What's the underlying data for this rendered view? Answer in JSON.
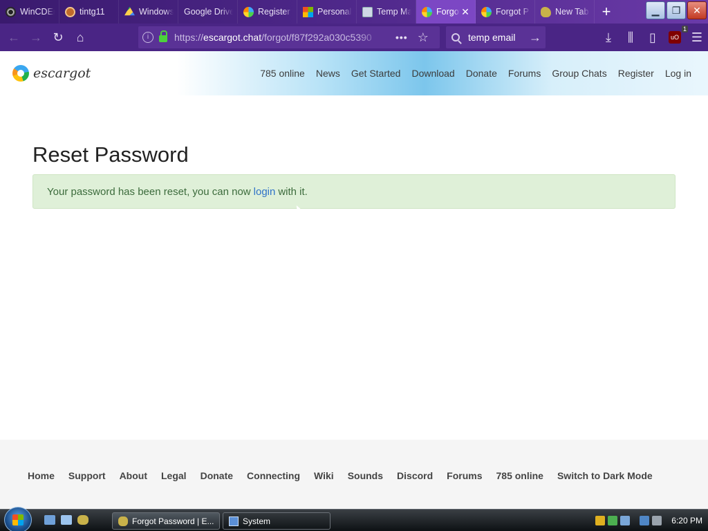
{
  "browser": {
    "tabs": [
      {
        "label": "WinCDEmu",
        "icon": "wincdemu-icon"
      },
      {
        "label": "tintg11",
        "icon": "tint-icon"
      },
      {
        "label": "Windows",
        "icon": "drive-icon"
      },
      {
        "label": "Google Drive",
        "icon": "none"
      },
      {
        "label": "Register",
        "icon": "escargot-icon"
      },
      {
        "label": "Personal",
        "icon": "microsoft-icon"
      },
      {
        "label": "Temp Mail",
        "icon": "mail-icon"
      },
      {
        "label": "Forgot",
        "icon": "escargot-icon"
      },
      {
        "label": "Forgot P",
        "icon": "escargot-icon"
      },
      {
        "label": "New Tab",
        "icon": "snail-icon"
      }
    ],
    "new_tab_symbol": "+",
    "url_host": "escargot.chat",
    "url_prefix": "https://",
    "url_path": "/forgot/f87f292a030c5390",
    "search_text": "temp email",
    "ublock_count": "1"
  },
  "site": {
    "logo_text": "escargot",
    "nav": [
      "785 online",
      "News",
      "Get Started",
      "Download",
      "Donate",
      "Forums",
      "Group Chats",
      "Register",
      "Log in"
    ],
    "page_title": "Reset Password",
    "alert": {
      "before": "Your password has been reset, you can now",
      "link": "login",
      "after": "with it."
    },
    "footer": [
      "Home",
      "Support",
      "About",
      "Legal",
      "Donate",
      "Connecting",
      "Wiki",
      "Sounds",
      "Discord",
      "Forums",
      "785 online",
      "Switch to Dark Mode"
    ]
  },
  "taskbar": {
    "buttons": [
      {
        "label": "Forgot Password | E..."
      },
      {
        "label": "System"
      }
    ],
    "clock": "6:20 PM"
  },
  "colors": {
    "tab_strip": "#4a2585",
    "active_tab": "#7c47c4",
    "alert_bg": "#dff0d8",
    "link": "#2f73c8"
  }
}
